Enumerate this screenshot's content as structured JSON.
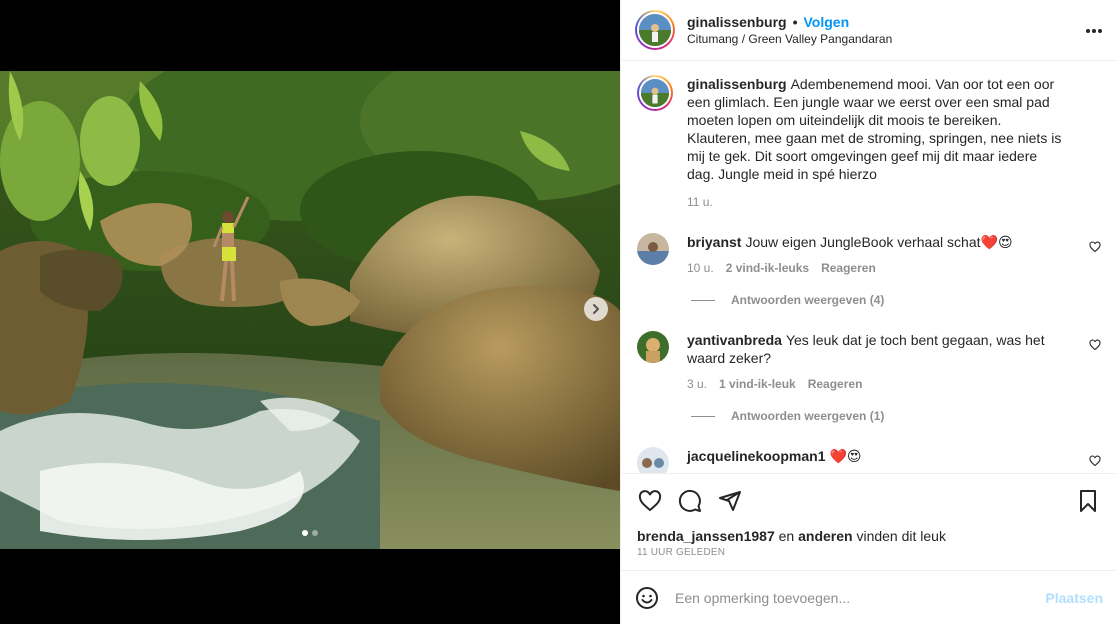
{
  "post": {
    "username": "ginalissenburg",
    "follow_label": "Volgen",
    "separator": "•",
    "location": "Citumang / Green Valley Pangandaran",
    "more_icon": "more-horizontal-icon",
    "carousel": {
      "dots": 2,
      "active_index": 0,
      "next_icon": "chevron-right-icon"
    }
  },
  "caption": {
    "username": "ginalissenburg",
    "text": "Adembenemend mooi. Van oor tot een oor een glimlach. Een jungle waar we eerst over een smal pad moeten lopen om uiteindelijk dit moois te bereiken. Klauteren, mee gaan met de stroming, springen, nee niets is mij te gek. Dit soort omgevingen geef mij dit maar iedere dag. Jungle meid in spé hierzo",
    "age": "11 u."
  },
  "comments": [
    {
      "username": "briyanst",
      "text": "Jouw eigen JungleBook verhaal schat❤️😍",
      "age": "10 u.",
      "likes": "2 vind-ik-leuks",
      "reply_label": "Reageren",
      "replies_label": "Antwoorden weergeven (4)"
    },
    {
      "username": "yantivanbreda",
      "text": "Yes leuk dat je toch bent gegaan, was het waard zeker?",
      "age": "3 u.",
      "likes": "1 vind-ik-leuk",
      "reply_label": "Reageren",
      "replies_label": "Antwoorden weergeven (1)"
    },
    {
      "username": "jacquelinekoopman1",
      "text": "❤️😍"
    }
  ],
  "actions": {
    "like_icon": "heart-icon",
    "comment_icon": "comment-icon",
    "share_icon": "send-icon",
    "save_icon": "bookmark-icon"
  },
  "likes": {
    "user": "brenda_janssen1987",
    "middle": " en ",
    "others": "anderen",
    "suffix": " vinden dit leuk"
  },
  "timestamp": "11 UUR GELEDEN",
  "add_comment": {
    "emoji_icon": "emoji-icon",
    "placeholder": "Een opmerking toevoegen...",
    "post_label": "Plaatsen"
  },
  "colors": {
    "link": "#0095f6",
    "post_disabled": "#b2dffc",
    "muted": "#8e8e8e",
    "heart": "#ed4956"
  }
}
